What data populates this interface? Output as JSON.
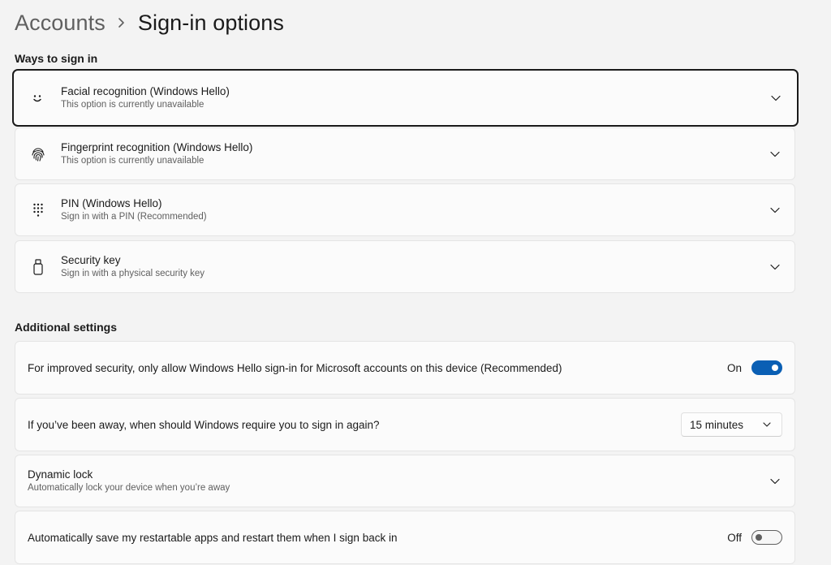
{
  "breadcrumb": {
    "parent": "Accounts",
    "current": "Sign-in options"
  },
  "ways_section": {
    "title": "Ways to sign in",
    "items": [
      {
        "title": "Facial recognition (Windows Hello)",
        "subtitle": "This option is currently unavailable",
        "icon": "face-smile-icon"
      },
      {
        "title": "Fingerprint recognition (Windows Hello)",
        "subtitle": "This option is currently unavailable",
        "icon": "fingerprint-icon"
      },
      {
        "title": "PIN (Windows Hello)",
        "subtitle": "Sign in with a PIN (Recommended)",
        "icon": "pin-keypad-icon"
      },
      {
        "title": "Security key",
        "subtitle": "Sign in with a physical security key",
        "icon": "usb-key-icon"
      }
    ]
  },
  "additional_section": {
    "title": "Additional settings",
    "hello_only": {
      "label": "For improved security, only allow Windows Hello sign-in for Microsoft accounts on this device (Recommended)",
      "state_label": "On",
      "enabled": true
    },
    "require_signin": {
      "label": "If you’ve been away, when should Windows require you to sign in again?",
      "selected": "15 minutes"
    },
    "dynamic_lock": {
      "title": "Dynamic lock",
      "subtitle": "Automatically lock your device when you’re away"
    },
    "restart_apps": {
      "label": "Automatically save my restartable apps and restart them when I sign back in",
      "state_label": "Off",
      "enabled": false
    }
  },
  "colors": {
    "accent": "#0a5fb4",
    "background": "#f3f3f3",
    "card": "#fbfbfb"
  }
}
